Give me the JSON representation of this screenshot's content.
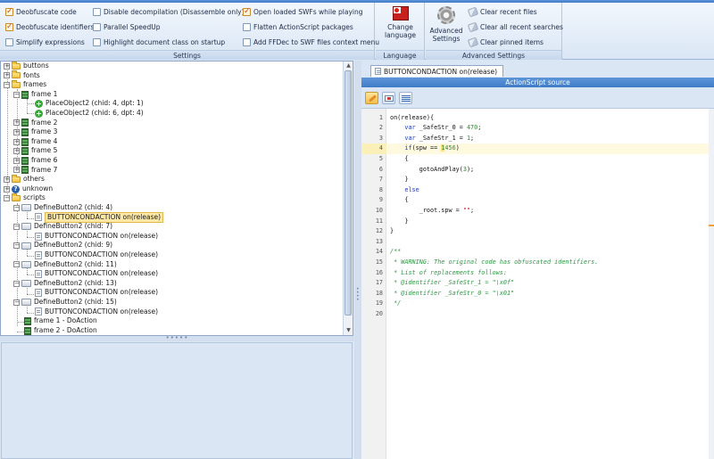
{
  "ribbon": {
    "settings": {
      "label": "Settings",
      "options": [
        {
          "label": "Deobfuscate code",
          "checked": true
        },
        {
          "label": "Deobfuscate identifiers",
          "checked": true
        },
        {
          "label": "Simplify expressions",
          "checked": false
        },
        {
          "label": "Disable decompilation (Disassemble only)",
          "checked": false
        },
        {
          "label": "Parallel SpeedUp",
          "checked": false
        },
        {
          "label": "Highlight document class on startup",
          "checked": false
        },
        {
          "label": "Open loaded SWFs while playing",
          "checked": true
        },
        {
          "label": "Flatten ActionScript packages",
          "checked": false
        },
        {
          "label": "Add FFDec to SWF files context menu",
          "checked": false
        }
      ]
    },
    "language": {
      "label": "Language",
      "button": "Change language"
    },
    "advanced": {
      "label": "Advanced Settings",
      "button": "Advanced Settings",
      "items": [
        "Clear recent files",
        "Clear all recent searches",
        "Clear pinned items"
      ]
    }
  },
  "tree": {
    "nodes": [
      {
        "label": "buttons"
      },
      {
        "label": "fonts"
      },
      {
        "label": "frames"
      },
      {
        "label": "frame 1"
      },
      {
        "label": "PlaceObject2 (chid: 4, dpt: 1)"
      },
      {
        "label": "PlaceObject2 (chid: 6, dpt: 4)"
      },
      {
        "label": "frame 2"
      },
      {
        "label": "frame 3"
      },
      {
        "label": "frame 4"
      },
      {
        "label": "frame 5"
      },
      {
        "label": "frame 6"
      },
      {
        "label": "frame 7"
      },
      {
        "label": "others"
      },
      {
        "label": "unknown"
      },
      {
        "label": "scripts"
      },
      {
        "label": "DefineButton2 (chid: 4)"
      },
      {
        "label": "BUTTONCONDACTION on(release)"
      },
      {
        "label": "DefineButton2 (chid: 7)"
      },
      {
        "label": "BUTTONCONDACTION on(release)"
      },
      {
        "label": "DefineButton2 (chid: 9)"
      },
      {
        "label": "BUTTONCONDACTION on(release)"
      },
      {
        "label": "DefineButton2 (chid: 11)"
      },
      {
        "label": "BUTTONCONDACTION on(release)"
      },
      {
        "label": "DefineButton2 (chid: 13)"
      },
      {
        "label": "BUTTONCONDACTION on(release)"
      },
      {
        "label": "DefineButton2 (chid: 15)"
      },
      {
        "label": "BUTTONCONDACTION on(release)"
      },
      {
        "label": "frame 1 - DoAction"
      },
      {
        "label": "frame 2 - DoAction"
      }
    ]
  },
  "editor": {
    "tab": "BUTTONCONDACTION on(release)",
    "header": "ActionScript source",
    "line_numbers": [
      "1",
      "2",
      "3",
      "4",
      "5",
      "6",
      "7",
      "8",
      "9",
      "10",
      "11",
      "12",
      "13",
      "14",
      "15",
      "16",
      "17",
      "18",
      "19",
      "20"
    ],
    "current_line": 4,
    "lines": {
      "l1": "on(release){",
      "l2_kw": "var",
      "l2_rest": " _SafeStr_0 = ",
      "l2_num": "470",
      "l2_end": ";",
      "l3_kw": "var",
      "l3_rest": " _SafeStr_1 = ",
      "l3_num": "1",
      "l3_end": ";",
      "l4_kw": "if",
      "l4_a": "(spw == ",
      "l4_hl": "1",
      "l4_num": "456",
      "l4_end": ")",
      "l5": "{",
      "l6_a": "gotoAndPlay(",
      "l6_num": "3",
      "l6_end": ");",
      "l7": "}",
      "l8": "else",
      "l9": "{",
      "l10_a": "_root.spw = ",
      "l10_str": "\"\"",
      "l10_end": ";",
      "l11": "}",
      "l12": "}",
      "l14": "/**",
      "l15": " * WARNING: The original code has obfuscated identifiers.",
      "l16": " * List of replacements follows:",
      "l17": " * @identifier _SafeStr_1 = \"\\x0f\"",
      "l18": " * @identifier _SafeStr_0 = \"\\x01\"",
      "l19": " */"
    }
  },
  "colors": {
    "accent": "#3f7cc8",
    "selection": "#fde8a6",
    "ribbon_bg": "#e6eef9"
  }
}
